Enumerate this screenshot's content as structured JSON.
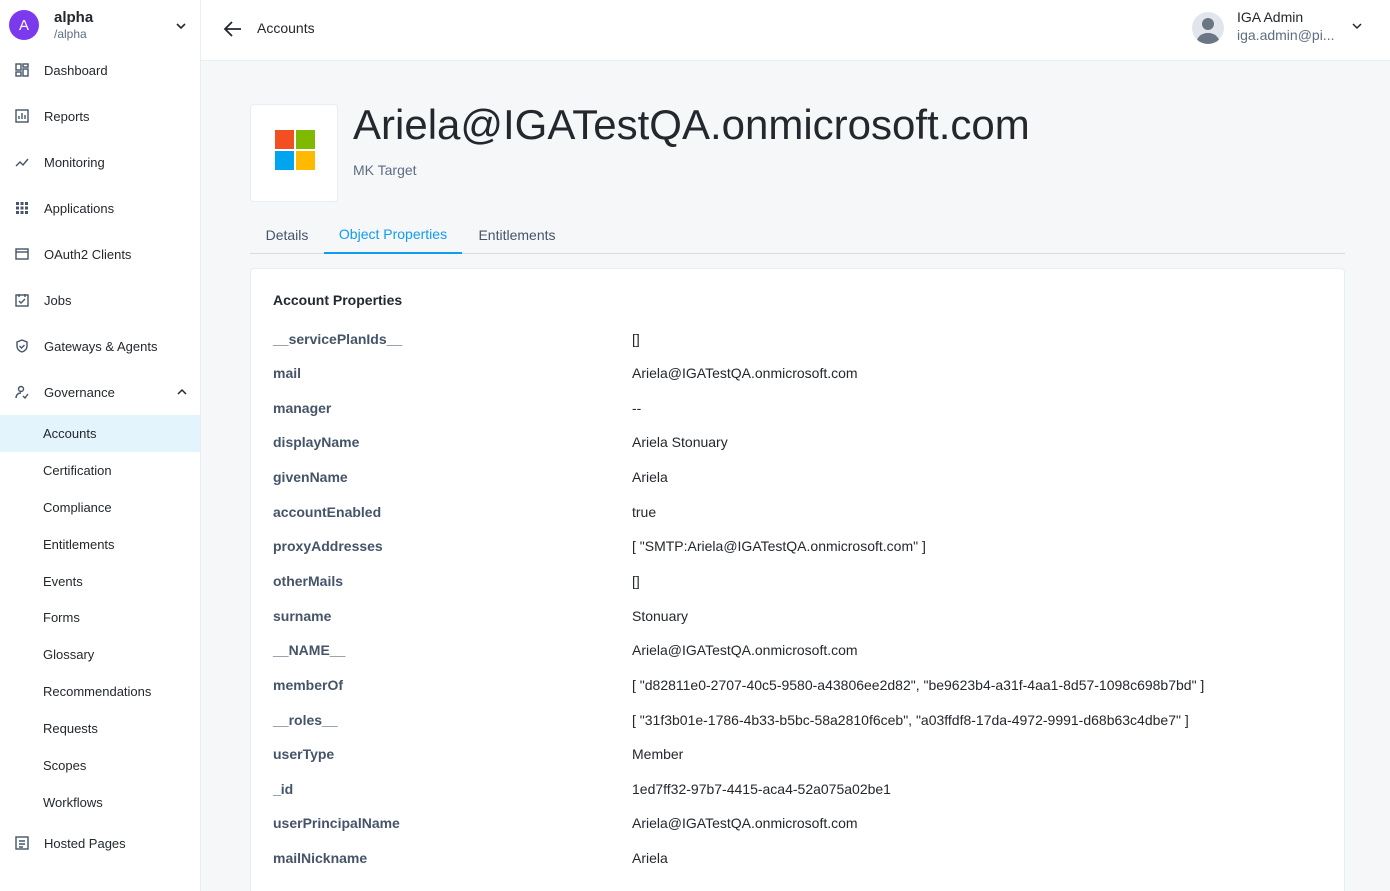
{
  "realm": {
    "initial": "A",
    "name": "alpha",
    "path": "/alpha"
  },
  "nav": {
    "items": [
      {
        "label": "Dashboard",
        "icon": "dashboard-icon"
      },
      {
        "label": "Reports",
        "icon": "reports-icon"
      },
      {
        "label": "Monitoring",
        "icon": "monitoring-icon"
      },
      {
        "label": "Applications",
        "icon": "applications-icon"
      },
      {
        "label": "OAuth2 Clients",
        "icon": "oauth2-clients-icon"
      },
      {
        "label": "Jobs",
        "icon": "jobs-icon"
      },
      {
        "label": "Gateways & Agents",
        "icon": "shield-icon"
      },
      {
        "label": "Governance",
        "icon": "governance-icon"
      }
    ],
    "governance_sub": [
      "Accounts",
      "Certification",
      "Compliance",
      "Entitlements",
      "Events",
      "Forms",
      "Glossary",
      "Recommendations",
      "Requests",
      "Scopes",
      "Workflows"
    ],
    "hosted_pages": "Hosted Pages",
    "active_sub": "Accounts"
  },
  "topbar": {
    "breadcrumb": "Accounts",
    "user_name": "IGA Admin",
    "user_email": "iga.admin@pi..."
  },
  "account": {
    "title": "Ariela@IGATestQA.onmicrosoft.com",
    "subtitle": "MK Target"
  },
  "tabs": [
    {
      "label": "Details",
      "active": false
    },
    {
      "label": "Object Properties",
      "active": true
    },
    {
      "label": "Entitlements",
      "active": false
    }
  ],
  "card": {
    "title": "Account Properties",
    "properties": [
      {
        "key": "__servicePlanIds__",
        "value": "[]"
      },
      {
        "key": "mail",
        "value": "Ariela@IGATestQA.onmicrosoft.com"
      },
      {
        "key": "manager",
        "value": "--"
      },
      {
        "key": "displayName",
        "value": "Ariela Stonuary"
      },
      {
        "key": "givenName",
        "value": "Ariela"
      },
      {
        "key": "accountEnabled",
        "value": "true"
      },
      {
        "key": "proxyAddresses",
        "value": "[ \"SMTP:Ariela@IGATestQA.onmicrosoft.com\" ]"
      },
      {
        "key": "otherMails",
        "value": "[]"
      },
      {
        "key": "surname",
        "value": "Stonuary"
      },
      {
        "key": "__NAME__",
        "value": "Ariela@IGATestQA.onmicrosoft.com"
      },
      {
        "key": "memberOf",
        "value": "[ \"d82811e0-2707-40c5-9580-a43806ee2d82\", \"be9623b4-a31f-4aa1-8d57-1098c698b7bd\" ]"
      },
      {
        "key": "__roles__",
        "value": "[ \"31f3b01e-1786-4b33-b5bc-58a2810f6ceb\", \"a03ffdf8-17da-4972-9991-d68b63c4dbe7\" ]"
      },
      {
        "key": "userType",
        "value": "Member"
      },
      {
        "key": "_id",
        "value": "1ed7ff32-97b7-4415-aca4-52a075a02be1"
      },
      {
        "key": "userPrincipalName",
        "value": "Ariela@IGATestQA.onmicrosoft.com"
      },
      {
        "key": "mailNickname",
        "value": "Ariela"
      }
    ]
  },
  "colors": {
    "accent": "#109cf1",
    "realm_avatar": "#7c3aed",
    "active_bg": "#e4f4fd",
    "ms_red": "#f25022",
    "ms_green": "#7fba00",
    "ms_blue": "#00a4ef",
    "ms_yellow": "#ffb900"
  }
}
